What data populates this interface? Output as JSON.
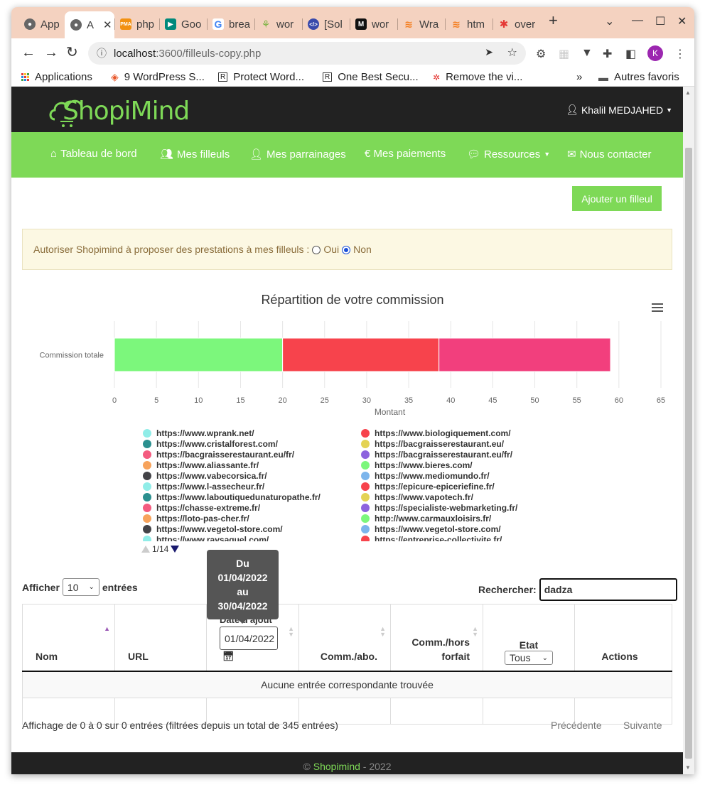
{
  "browser": {
    "tabs": [
      {
        "label": "App",
        "favicon": "globe-icon"
      },
      {
        "label": "A",
        "favicon": "globe-icon",
        "active": true
      },
      {
        "label": "php",
        "favicon": "pma-icon"
      },
      {
        "label": "Goo",
        "favicon": "gmeet-icon"
      },
      {
        "label": "brea",
        "favicon": "google-icon"
      },
      {
        "label": "wor",
        "favicon": "leaf-icon"
      },
      {
        "label": "[Sol",
        "favicon": "code-icon"
      },
      {
        "label": "wor",
        "favicon": "m-icon"
      },
      {
        "label": "Wra",
        "favicon": "stackoverflow-icon"
      },
      {
        "label": "htm",
        "favicon": "stackoverflow-icon"
      },
      {
        "label": "over",
        "favicon": "asterisk-icon"
      }
    ],
    "new_tab": "+",
    "url_host": "localhost",
    "url_path": ":3600/filleuls-copy.php",
    "profile_initial": "K",
    "bookmarks": [
      {
        "label": "Applications"
      },
      {
        "label": "9 WordPress S..."
      },
      {
        "label": "Protect Word..."
      },
      {
        "label": "One Best Secu..."
      },
      {
        "label": "Remove the vi..."
      }
    ],
    "bookmarks_overflow": "»",
    "other_bookmarks": "Autres favoris"
  },
  "site": {
    "logo": "ShopiMind",
    "user": "Khalil MEDJAHED",
    "menu": [
      {
        "label": "Tableau de bord",
        "icon": "home-icon"
      },
      {
        "label": "Mes filleuls",
        "icon": "users-icon"
      },
      {
        "label": "Mes parrainages",
        "icon": "user-plus-icon"
      },
      {
        "label": "€ Mes paiements",
        "icon": ""
      },
      {
        "label": "Ressources",
        "icon": "comments-icon",
        "dropdown": true
      },
      {
        "label": "Nous contacter",
        "icon": "envelope-icon"
      }
    ],
    "add_button": "Ajouter un filleul",
    "alert": {
      "text": "Autoriser Shopimind à proposer des prestations à mes filleuls :",
      "option_yes": "Oui",
      "option_no": "Non",
      "selected": "Non"
    }
  },
  "chart_data": {
    "type": "bar",
    "orientation": "horizontal",
    "stacked": true,
    "title": "Répartition de votre commission",
    "categories": [
      "Commission totale"
    ],
    "xlabel": "Montant",
    "xlim": [
      0,
      65
    ],
    "xticks": [
      0,
      5,
      10,
      15,
      20,
      25,
      30,
      35,
      40,
      45,
      50,
      55,
      60,
      65
    ],
    "grid": true,
    "series": [
      {
        "name": "https://www.wprank.net/",
        "color": "#7cf77c",
        "values": [
          20
        ]
      },
      {
        "name": "https://www.biologiquement.com/",
        "color": "#f7434c",
        "values": [
          18.6
        ]
      },
      {
        "name": "https://www.cristalforest.com/",
        "color": "#f23f7d",
        "values": [
          20.4
        ]
      }
    ],
    "legend": {
      "position": "bottom",
      "page": "1/14",
      "columns": [
        [
          {
            "label": "https://www.wprank.net/",
            "color": "#90ede8"
          },
          {
            "label": "https://www.cristalforest.com/",
            "color": "#2b908f"
          },
          {
            "label": "https://bacgraisserestaurant.eu/fr/",
            "color": "#f45b7f"
          },
          {
            "label": "https://www.aliassante.fr/",
            "color": "#f7a35c"
          },
          {
            "label": "https://www.vabecorsica.fr/",
            "color": "#434348"
          },
          {
            "label": "https://www.l-assecheur.fr/",
            "color": "#90ede8"
          },
          {
            "label": "https://www.laboutiquedunaturopathe.fr/",
            "color": "#2b908f"
          },
          {
            "label": "https://chasse-extreme.fr/",
            "color": "#f45b7f"
          },
          {
            "label": "https://loto-pas-cher.fr/",
            "color": "#f7a35c"
          },
          {
            "label": "https://www.vegetol-store.com/",
            "color": "#434348"
          },
          {
            "label": "https://www.ravsaquel.com/",
            "color": "#90ede8"
          }
        ],
        [
          {
            "label": "https://www.biologiquement.com/",
            "color": "#f7434c"
          },
          {
            "label": "https://bacgraisserestaurant.eu/",
            "color": "#e4d354"
          },
          {
            "label": "https://bacgraisserestaurant.eu/fr/",
            "color": "#8d63de"
          },
          {
            "label": "https://www.bieres.com/",
            "color": "#7cf77c"
          },
          {
            "label": "https://www.mediomundo.fr/",
            "color": "#7cb5ec"
          },
          {
            "label": "https://epicure-epiceriefine.fr/",
            "color": "#f7434c"
          },
          {
            "label": "https://www.vapotech.fr/",
            "color": "#e4d354"
          },
          {
            "label": "https://specialiste-webmarketing.fr/",
            "color": "#8d63de"
          },
          {
            "label": "http://www.carmauxloisirs.fr/",
            "color": "#7cf77c"
          },
          {
            "label": "https://www.vegetol-store.com/",
            "color": "#7cb5ec"
          },
          {
            "label": "https://entreprise-collectivite.fr/",
            "color": "#f7434c"
          }
        ]
      ]
    }
  },
  "datepicker_tooltip": {
    "line1": "Du",
    "line2": "01/04/2022",
    "line3": "au",
    "line4": "30/04/2022"
  },
  "table": {
    "length_label_before": "Afficher",
    "length_value": "10",
    "length_label_after": "entrées",
    "search_label": "Rechercher:",
    "search_value": "dadza",
    "columns": {
      "nom": "Nom",
      "url": "URL",
      "date": "Date d'ajout",
      "date_value": "01/04/2022",
      "comm_abo": "Comm./abo.",
      "comm_hors_1": "Comm./hors",
      "comm_hors_2": "forfait",
      "etat": "Etat",
      "etat_value": "Tous",
      "actions": "Actions"
    },
    "empty_text": "Aucune entrée correspondante trouvée",
    "info": "Affichage de 0 à 0 sur 0 entrées (filtrées depuis un total de 345 entrées)",
    "prev": "Précédente",
    "next": "Suivante"
  },
  "footer": {
    "copy": "©",
    "brand": "Shopimind",
    "year": "- 2022"
  }
}
